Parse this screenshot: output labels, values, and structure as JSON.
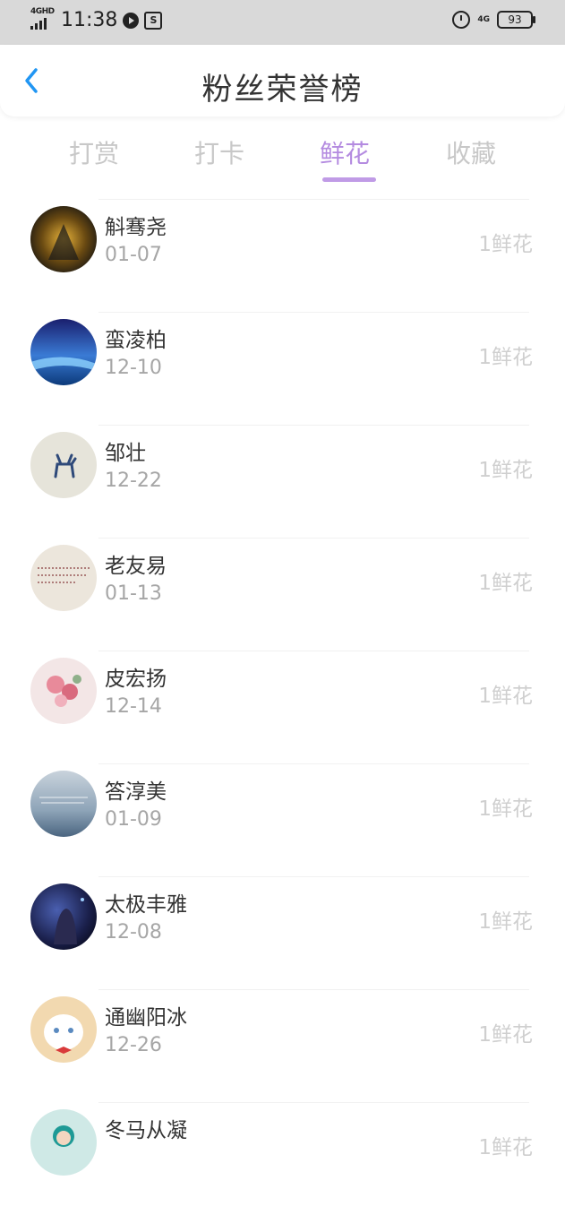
{
  "status_bar": {
    "network": "4GHD",
    "time": "11:38",
    "network_right": "4G",
    "battery": "93",
    "icons": [
      "signal-icon",
      "play-icon",
      "screenshot-icon",
      "alarm-icon",
      "battery-icon"
    ]
  },
  "header": {
    "title": "粉丝荣誉榜",
    "back_icon": "chevron-left-icon"
  },
  "tabs": [
    {
      "label": "打赏",
      "active": false
    },
    {
      "label": "打卡",
      "active": false
    },
    {
      "label": "鲜花",
      "active": true
    },
    {
      "label": "收藏",
      "active": false
    }
  ],
  "colors": {
    "accent": "#b48be0",
    "muted": "#c8c8c8",
    "status_bar": "#d9d9d9"
  },
  "fans": [
    {
      "name": "斛骞尧",
      "date": "01-07",
      "count": "1鲜花"
    },
    {
      "name": "蛮凌柏",
      "date": "12-10",
      "count": "1鲜花"
    },
    {
      "name": "邹壮",
      "date": "12-22",
      "count": "1鲜花"
    },
    {
      "name": "老友易",
      "date": "01-13",
      "count": "1鲜花"
    },
    {
      "name": "皮宏扬",
      "date": "12-14",
      "count": "1鲜花"
    },
    {
      "name": "答淳美",
      "date": "01-09",
      "count": "1鲜花"
    },
    {
      "name": "太极丰雅",
      "date": "12-08",
      "count": "1鲜花"
    },
    {
      "name": "通幽阳冰",
      "date": "12-26",
      "count": "1鲜花"
    },
    {
      "name": "冬马从凝",
      "date": "",
      "count": "1鲜花"
    }
  ]
}
